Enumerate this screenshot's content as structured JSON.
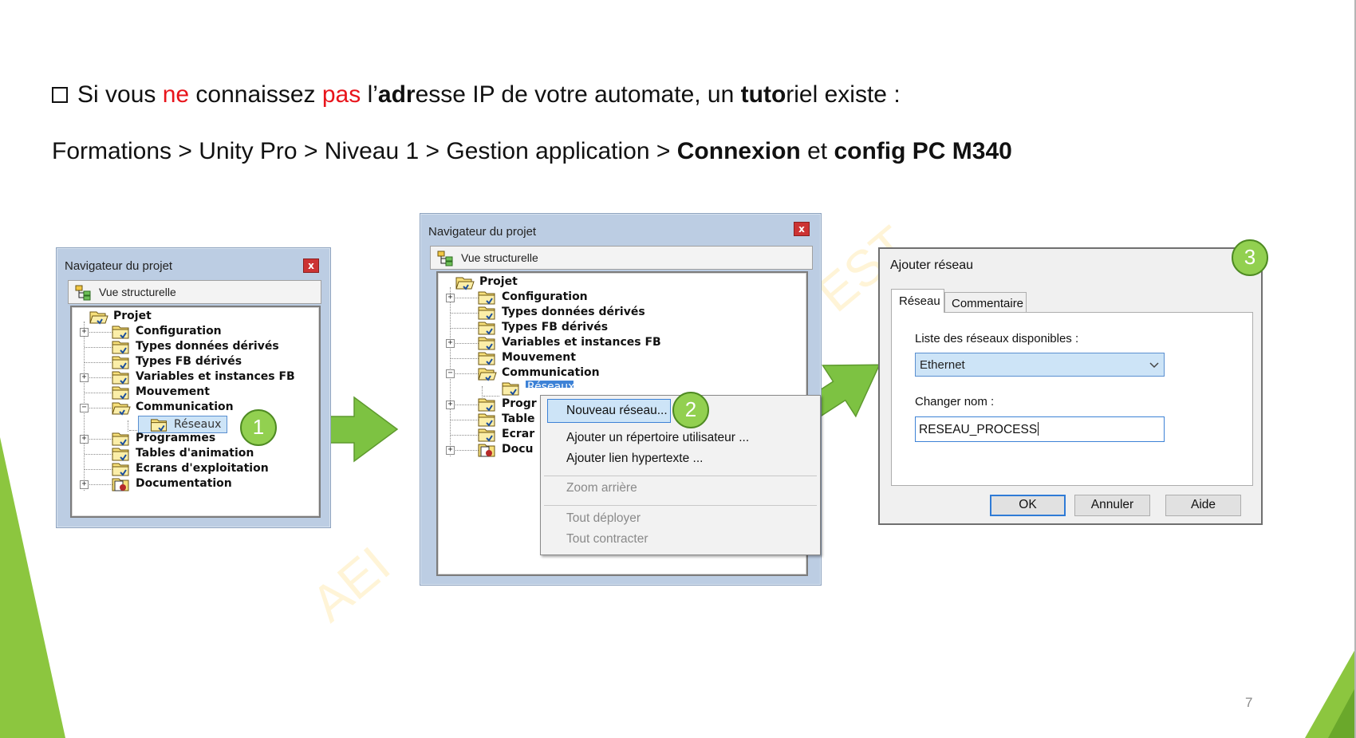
{
  "slide": {
    "line1": {
      "p1": "Si vous ",
      "p2": "ne",
      "p3": " connaissez ",
      "p4": "pas",
      "p5": " l’",
      "p6": "adr",
      "p7": "esse IP de votre automate, un ",
      "p8": "tuto",
      "p9": "riel existe :"
    },
    "line2": {
      "p1": "Formations > Unity Pro > Niveau 1 > Gestion application > ",
      "p2": "Connexion",
      "p3": " et ",
      "p4": "config PC M340"
    },
    "page_number": "7",
    "watermark_left": "AEI",
    "watermark_right": "EST"
  },
  "colors": {
    "accent_green": "#92d050",
    "arrow_green": "#7dc242",
    "highlight_red": "#e8141b",
    "selection_blue": "#cde4f7",
    "window_frame": "#bccde3"
  },
  "navigator1": {
    "title": "Navigateur du projet",
    "close": "x",
    "view": "Vue structurelle",
    "tree": {
      "root": "Projet",
      "configuration": "Configuration",
      "types_donnees": "Types données dérivés",
      "types_fb": "Types FB dérivés",
      "variables": "Variables et instances FB",
      "mouvement": "Mouvement",
      "communication": "Communication",
      "reseaux": "Réseaux",
      "programmes": "Programmes",
      "tables": "Tables d'animation",
      "ecrans": "Ecrans d'exploitation",
      "documentation": "Documentation"
    },
    "badge": "1"
  },
  "navigator2": {
    "title": "Navigateur du projet",
    "close": "x",
    "view": "Vue structurelle",
    "tree": {
      "root": "Projet",
      "configuration": "Configuration",
      "types_donnees": "Types données dérivés",
      "types_fb": "Types FB dérivés",
      "variables": "Variables et instances FB",
      "mouvement": "Mouvement",
      "communication": "Communication",
      "reseaux": "Réseaux",
      "programmes": "Progr",
      "tables": "Table",
      "ecrans": "Ecrar",
      "documentation": "Docu"
    },
    "badge": "2",
    "context_menu": {
      "new_network": "Nouveau réseau...",
      "add_user_dir": "Ajouter un répertoire utilisateur ...",
      "add_hyperlink": "Ajouter lien hypertexte ...",
      "zoom_out": "Zoom arrière",
      "expand_all": "Tout déployer",
      "collapse_all": "Tout contracter"
    }
  },
  "dialog": {
    "title": "Ajouter réseau",
    "badge": "3",
    "tabs": {
      "reseau": "Réseau",
      "commentaire": "Commentaire"
    },
    "list_label": "Liste des réseaux disponibles :",
    "network_selected": "Ethernet",
    "rename_label": "Changer nom :",
    "name_value": "RESEAU_PROCESS",
    "buttons": {
      "ok": "OK",
      "cancel": "Annuler",
      "help": "Aide"
    }
  }
}
